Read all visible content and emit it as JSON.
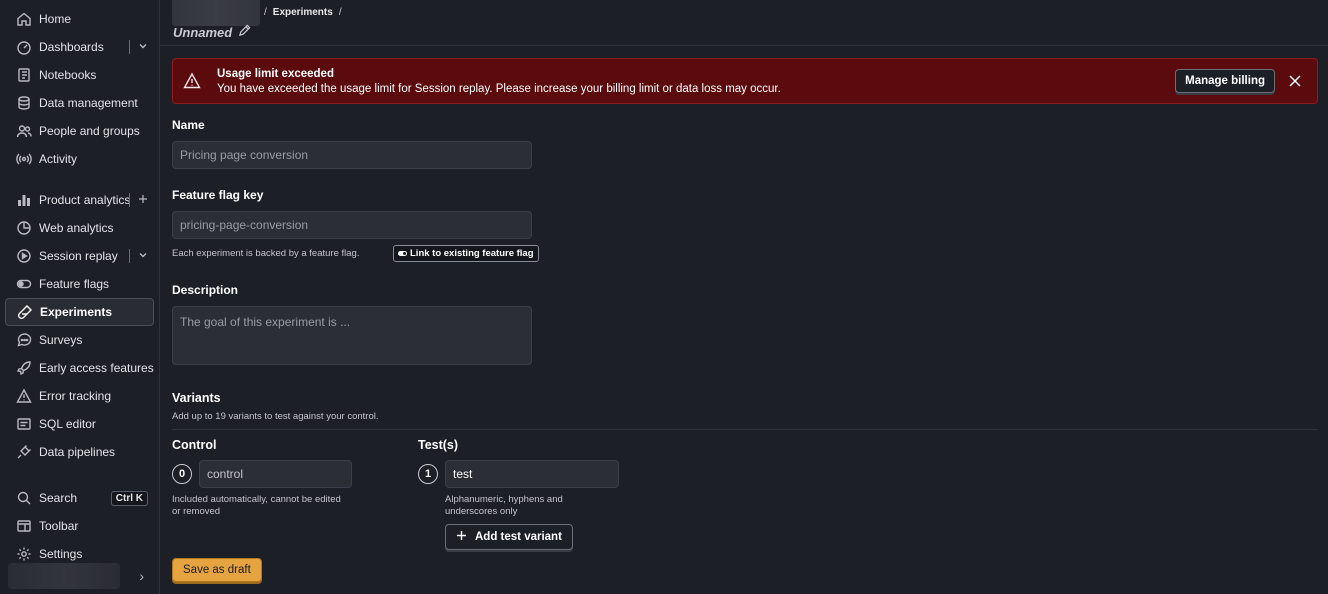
{
  "sidebar": {
    "items": [
      {
        "label": "Home",
        "icon": "home-icon"
      },
      {
        "label": "Dashboards",
        "icon": "dashboard-icon"
      },
      {
        "label": "Notebooks",
        "icon": "notebook-icon"
      },
      {
        "label": "Data management",
        "icon": "database-icon"
      },
      {
        "label": "People and groups",
        "icon": "people-icon"
      },
      {
        "label": "Activity",
        "icon": "activity-icon"
      },
      {
        "label": "Product analytics",
        "icon": "bar-chart-icon"
      },
      {
        "label": "Web analytics",
        "icon": "pie-chart-icon"
      },
      {
        "label": "Session replay",
        "icon": "replay-icon"
      },
      {
        "label": "Feature flags",
        "icon": "toggle-icon"
      },
      {
        "label": "Experiments",
        "icon": "flask-icon"
      },
      {
        "label": "Surveys",
        "icon": "chat-bubble-icon"
      },
      {
        "label": "Early access features",
        "icon": "rocket-icon"
      },
      {
        "label": "Error tracking",
        "icon": "warning-icon"
      },
      {
        "label": "SQL editor",
        "icon": "sql-icon"
      },
      {
        "label": "Data pipelines",
        "icon": "plug-icon"
      }
    ],
    "bottom": [
      {
        "label": "Search",
        "icon": "search-icon",
        "shortcut": "Ctrl K"
      },
      {
        "label": "Toolbar",
        "icon": "toolbar-icon"
      },
      {
        "label": "Settings",
        "icon": "gear-icon"
      }
    ]
  },
  "header": {
    "breadcrumb_separator": "/",
    "breadcrumb": "Experiments",
    "title": "Unnamed"
  },
  "alert": {
    "title": "Usage limit exceeded",
    "message": "You have exceeded the usage limit for Session replay. Please increase your billing limit or data loss may occur.",
    "action_label": "Manage billing",
    "color": "#5b0b0d"
  },
  "form": {
    "name_label": "Name",
    "name_placeholder": "Pricing page conversion",
    "flag_label": "Feature flag key",
    "flag_placeholder": "pricing-page-conversion",
    "flag_hint": "Each experiment is backed by a feature flag.",
    "link_flag_label": "Link to existing feature flag",
    "description_label": "Description",
    "description_placeholder": "The goal of this experiment is ...",
    "variants_label": "Variants",
    "variants_hint": "Add up to 19 variants to test against your control.",
    "control_title": "Control",
    "control_number": "0",
    "control_value": "control",
    "control_hint_1": "Included automatically, cannot be edited",
    "control_hint_2": "or removed",
    "test_title": "Test(s)",
    "test_number": "1",
    "test_value": "test",
    "test_hint_1": "Alphanumeric, hyphens and",
    "test_hint_2": "underscores only",
    "add_variant_label": "Add test variant",
    "save_label": "Save as draft",
    "accent": "#e5a43f"
  }
}
